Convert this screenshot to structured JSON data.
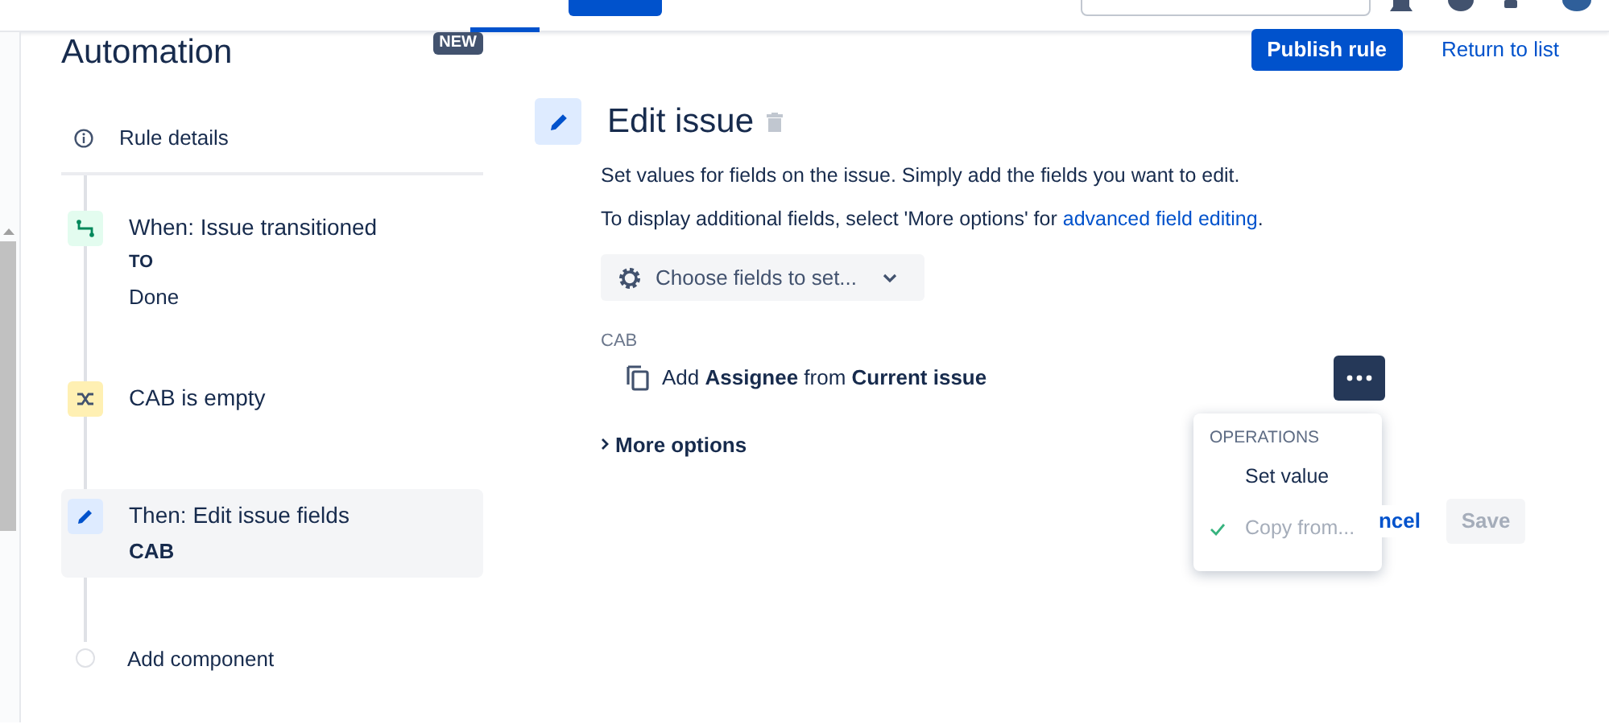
{
  "app_title": "Automation",
  "badge": "NEW",
  "actions": {
    "publish": "Publish rule",
    "return": "Return to list"
  },
  "sidebar": {
    "rule_details": "Rule details",
    "steps": [
      {
        "kind": "trigger",
        "title": "When: Issue transitioned",
        "details": [
          "TO",
          "Done"
        ],
        "selected": false
      },
      {
        "kind": "condition",
        "title": "CAB is empty",
        "selected": false
      },
      {
        "kind": "action",
        "title": "Then: Edit issue fields",
        "subtitle": "CAB",
        "selected": true
      }
    ],
    "add": "Add component"
  },
  "editor": {
    "title": "Edit issue",
    "description": "Set values for fields on the issue. Simply add the fields you want to edit.",
    "hint": {
      "text": "To display additional fields, select 'More options' for",
      "link": "advanced field editing",
      "end": "."
    },
    "choose": "Choose fields to set...",
    "field_label": "CAB",
    "field_value": "Add **Assignee** from **Current issue**",
    "more": "More options",
    "menu": {
      "heading": "OPERATIONS",
      "items": [
        {
          "label": "Set value",
          "selected": false
        },
        {
          "label": "Copy from...",
          "selected": true
        }
      ]
    },
    "cancel": "ncel",
    "save": {
      "label": "Save",
      "disabled": true
    }
  }
}
